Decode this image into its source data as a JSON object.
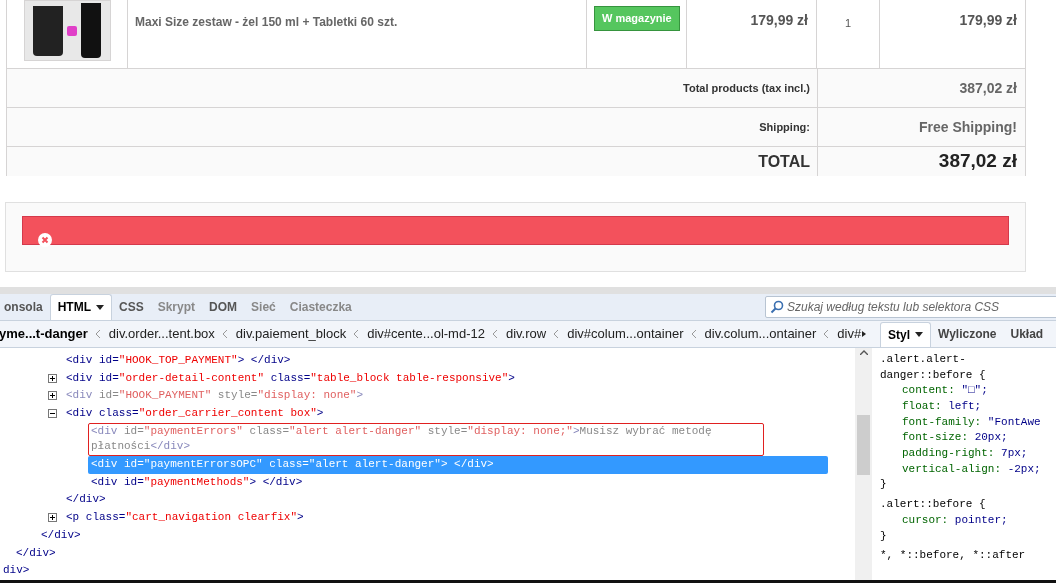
{
  "cart": {
    "product": {
      "name": "Maxi Size zestaw - żel 150 ml + Tabletki 60 szt.",
      "availability": "W magazynie",
      "unit_price": "179,99 zł",
      "quantity": "1",
      "total": "179,99 zł"
    },
    "summary": [
      {
        "kind": "normal",
        "label": "Total products (tax incl.)",
        "value": "387,02 zł"
      },
      {
        "kind": "normal",
        "label": "Shipping:",
        "value": "Free Shipping!"
      },
      {
        "kind": "total",
        "label": "TOTAL",
        "value": "387,02 zł"
      }
    ]
  },
  "alert": {
    "kind": "danger"
  },
  "devtools": {
    "tabs": [
      {
        "label": "onsola",
        "selected": false,
        "disabled": false,
        "menu": false
      },
      {
        "label": "HTML",
        "selected": true,
        "disabled": false,
        "menu": true
      },
      {
        "label": "CSS",
        "selected": false,
        "disabled": false,
        "menu": false
      },
      {
        "label": "Skrypt",
        "selected": false,
        "disabled": true,
        "menu": false
      },
      {
        "label": "DOM",
        "selected": false,
        "disabled": false,
        "menu": false
      },
      {
        "label": "Sieć",
        "selected": false,
        "disabled": true,
        "menu": false
      },
      {
        "label": "Ciasteczka",
        "selected": false,
        "disabled": true,
        "menu": false
      }
    ],
    "search": {
      "placeholder": "Szukaj według tekstu lub selektora CSS"
    },
    "breadcrumbs": [
      {
        "label": "yme...t-danger",
        "selected": true
      },
      {
        "label": "div.order...tent.box",
        "selected": false
      },
      {
        "label": "div.paiement_block",
        "selected": false
      },
      {
        "label": "div#cente...ol-md-12",
        "selected": false
      },
      {
        "label": "div.row",
        "selected": false
      },
      {
        "label": "div#colum...ontainer",
        "selected": false
      },
      {
        "label": "div.colum...ontainer",
        "selected": false
      },
      {
        "label": "div#",
        "selected": false
      }
    ],
    "tree": [
      {
        "close": [
          {
            "kind": "tag",
            "text": "div>"
          }
        ],
        "children": [
          {
            "close": [
              {
                "kind": "tag",
                "text": "</div>"
              }
            ],
            "children": [
              {
                "close": [
                  {
                    "kind": "tag",
                    "text": "</div>"
                  }
                ],
                "children": [
                  {
                    "selected": false,
                    "hidden": false,
                    "outlined": false,
                    "open": [
                      {
                        "kind": "tag",
                        "text": "<div"
                      },
                      {
                        "kind": "attr",
                        "text": " id="
                      },
                      {
                        "kind": "value",
                        "text": "\"HOOK_TOP_PAYMENT\""
                      },
                      {
                        "kind": "tag",
                        "text": "> </div>"
                      }
                    ]
                  },
                  {
                    "selected": false,
                    "hidden": false,
                    "outlined": false,
                    "expanded": false,
                    "open": [
                      {
                        "kind": "tag",
                        "text": "<div"
                      },
                      {
                        "kind": "attr",
                        "text": " id="
                      },
                      {
                        "kind": "value",
                        "text": "\"order-detail-content\""
                      },
                      {
                        "kind": "attr",
                        "text": " class="
                      },
                      {
                        "kind": "value",
                        "text": "\"table_block table-responsive\""
                      },
                      {
                        "kind": "tag",
                        "text": ">"
                      }
                    ]
                  },
                  {
                    "selected": false,
                    "hidden": true,
                    "outlined": false,
                    "expanded": false,
                    "open": [
                      {
                        "kind": "tag",
                        "text": "<div"
                      },
                      {
                        "kind": "attr",
                        "text": " id="
                      },
                      {
                        "kind": "value",
                        "text": "\"HOOK_PAYMENT\""
                      },
                      {
                        "kind": "attr",
                        "text": " style="
                      },
                      {
                        "kind": "value",
                        "text": "\"display: none\""
                      },
                      {
                        "kind": "tag",
                        "text": ">"
                      }
                    ]
                  },
                  {
                    "selected": false,
                    "hidden": false,
                    "outlined": false,
                    "expanded": true,
                    "open": [
                      {
                        "kind": "tag",
                        "text": "<div"
                      },
                      {
                        "kind": "attr",
                        "text": " class="
                      },
                      {
                        "kind": "value",
                        "text": "\"order_carrier_content box\""
                      },
                      {
                        "kind": "tag",
                        "text": ">"
                      }
                    ],
                    "close": [
                      {
                        "kind": "tag",
                        "text": "</div>"
                      }
                    ],
                    "children": [
                      {
                        "selected": false,
                        "hidden": true,
                        "outlined": true,
                        "open": [
                          {
                            "kind": "tag",
                            "text": "<div"
                          },
                          {
                            "kind": "attr",
                            "text": " id="
                          },
                          {
                            "kind": "value",
                            "text": "\"paymentErrors\""
                          },
                          {
                            "kind": "attr",
                            "text": " class="
                          },
                          {
                            "kind": "value",
                            "text": "\"alert alert-danger\""
                          },
                          {
                            "kind": "attr",
                            "text": " style="
                          },
                          {
                            "kind": "value",
                            "text": "\"display: none;\""
                          },
                          {
                            "kind": "tag",
                            "text": ">"
                          },
                          {
                            "kind": "text",
                            "text": "Musisz wybrać metodę płatności"
                          },
                          {
                            "kind": "tag",
                            "text": "</div>"
                          }
                        ]
                      },
                      {
                        "selected": true,
                        "hidden": false,
                        "outlined": false,
                        "open": [
                          {
                            "kind": "tag",
                            "text": "<div"
                          },
                          {
                            "kind": "attr",
                            "text": " id="
                          },
                          {
                            "kind": "value",
                            "text": "\"paymentErrorsOPC\""
                          },
                          {
                            "kind": "attr",
                            "text": " class="
                          },
                          {
                            "kind": "value",
                            "text": "\"alert alert-danger\""
                          },
                          {
                            "kind": "tag",
                            "text": "> </div>"
                          }
                        ]
                      },
                      {
                        "selected": false,
                        "hidden": false,
                        "outlined": false,
                        "open": [
                          {
                            "kind": "tag",
                            "text": "<div"
                          },
                          {
                            "kind": "attr",
                            "text": " id="
                          },
                          {
                            "kind": "value",
                            "text": "\"paymentMethods\""
                          },
                          {
                            "kind": "tag",
                            "text": "> </div>"
                          }
                        ]
                      }
                    ]
                  },
                  {
                    "selected": false,
                    "hidden": false,
                    "outlined": false,
                    "expanded": false,
                    "open": [
                      {
                        "kind": "tag",
                        "text": "<p"
                      },
                      {
                        "kind": "attr",
                        "text": " class="
                      },
                      {
                        "kind": "value",
                        "text": "\"cart_navigation clearfix\""
                      },
                      {
                        "kind": "tag",
                        "text": ">"
                      }
                    ]
                  }
                ]
              }
            ]
          }
        ]
      }
    ],
    "side_tabs": [
      {
        "label": "Styl",
        "selected": true,
        "menu": true
      },
      {
        "label": "Wyliczone",
        "selected": false,
        "menu": false
      },
      {
        "label": "Układ",
        "selected": false,
        "menu": false
      }
    ],
    "rules": [
      {
        "selector": ".alert.alert-danger::before {",
        "declarations": [
          {
            "property": "content:",
            "value": "\"□\";"
          },
          {
            "property": "float:",
            "value": "left;"
          },
          {
            "property": "font-family:",
            "value": "\"FontAwe"
          },
          {
            "property": "font-size:",
            "value": "20px;"
          },
          {
            "property": "padding-right:",
            "value": "7px;"
          },
          {
            "property": "vertical-align:",
            "value": "-2px;"
          }
        ],
        "end": "}"
      },
      {
        "selector": ".alert::before {",
        "declarations": [
          {
            "property": "cursor:",
            "value": "pointer;"
          }
        ],
        "end": "}"
      },
      {
        "selector": "*, *::before, *::after"
      }
    ]
  }
}
